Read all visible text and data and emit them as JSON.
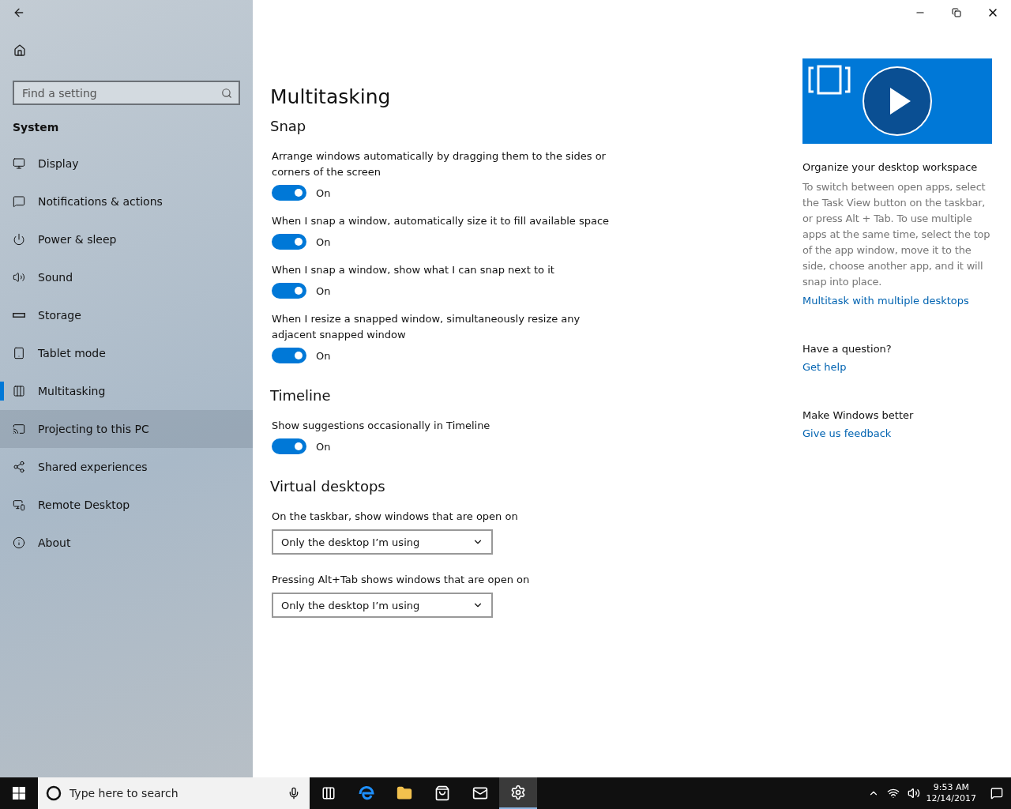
{
  "sidebar": {
    "search": {
      "placeholder": "Find a setting"
    },
    "section": "System",
    "items": [
      {
        "label": "Display",
        "selected": false,
        "hovered": false
      },
      {
        "label": "Notifications & actions",
        "selected": false,
        "hovered": false
      },
      {
        "label": "Power & sleep",
        "selected": false,
        "hovered": false
      },
      {
        "label": "Sound",
        "selected": false,
        "hovered": false
      },
      {
        "label": "Storage",
        "selected": false,
        "hovered": false
      },
      {
        "label": "Tablet mode",
        "selected": false,
        "hovered": false
      },
      {
        "label": "Multitasking",
        "selected": true,
        "hovered": false
      },
      {
        "label": "Projecting to this PC",
        "selected": false,
        "hovered": true
      },
      {
        "label": "Shared experiences",
        "selected": false,
        "hovered": false
      },
      {
        "label": "Remote Desktop",
        "selected": false,
        "hovered": false
      },
      {
        "label": "About",
        "selected": false,
        "hovered": false
      }
    ]
  },
  "page_title": "Multitasking",
  "sections": [
    {
      "title": "Snap",
      "settings": [
        {
          "kind": "toggle",
          "label": "Arrange windows automatically by dragging them to the sides or corners of the screen",
          "on": true,
          "state_text": "On"
        },
        {
          "kind": "toggle",
          "label": "When I snap a window, automatically size it to fill available space",
          "on": true,
          "state_text": "On"
        },
        {
          "kind": "toggle",
          "label": "When I snap a window, show what I can snap next to it",
          "on": true,
          "state_text": "On"
        },
        {
          "kind": "toggle",
          "label": "When I resize a snapped window, simultaneously resize any adjacent snapped window",
          "on": true,
          "state_text": "On"
        }
      ]
    },
    {
      "title": "Timeline",
      "settings": [
        {
          "kind": "toggle",
          "label": "Show suggestions occasionally in Timeline",
          "on": true,
          "state_text": "On"
        }
      ]
    },
    {
      "title": "Virtual desktops",
      "settings": [
        {
          "kind": "dropdown",
          "label": "On the taskbar, show windows that are open on",
          "value": "Only the desktop I’m using"
        },
        {
          "kind": "dropdown",
          "label": "Pressing Alt+Tab shows windows that are open on",
          "value": "Only the desktop I’m using"
        }
      ]
    }
  ],
  "aside": {
    "heading": "Organize your desktop workspace",
    "body": "To switch between open apps, select the Task View button on the taskbar, or press Alt + Tab. To use multiple apps at the same time, select the top of the app window, move it to the side, choose another app, and it will snap into place.",
    "link": "Multitask with multiple desktops",
    "groups": [
      {
        "heading": "Have a question?",
        "link": "Get help"
      },
      {
        "heading": "Make Windows better",
        "link": "Give us feedback"
      }
    ]
  },
  "taskbar": {
    "search": {
      "placeholder": "Type here to search"
    },
    "time": "9:53 AM",
    "date": "12/14/2017"
  }
}
